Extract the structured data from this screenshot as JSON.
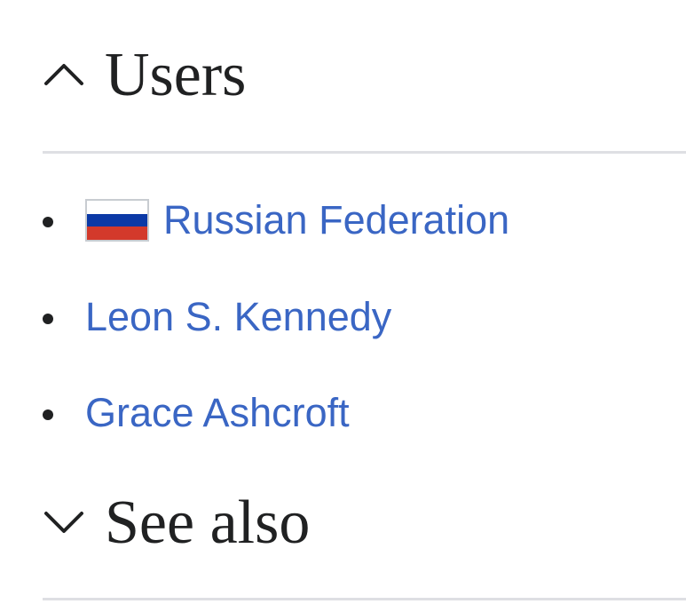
{
  "sections": {
    "users": {
      "title": "Users",
      "expanded": true,
      "icon": "chevron-up-icon",
      "items": [
        {
          "label": "Russian Federation",
          "flag": "russia-flag-icon",
          "flag_colors": [
            "#ffffff",
            "#0b39a6",
            "#d3392b"
          ]
        },
        {
          "label": "Leon S. Kennedy"
        },
        {
          "label": "Grace Ashcroft"
        }
      ]
    },
    "see_also": {
      "title": "See also",
      "expanded": false,
      "icon": "chevron-down-icon"
    }
  },
  "colors": {
    "link": "#3a66c4",
    "heading": "#202122",
    "divider": "#dedfe3"
  }
}
